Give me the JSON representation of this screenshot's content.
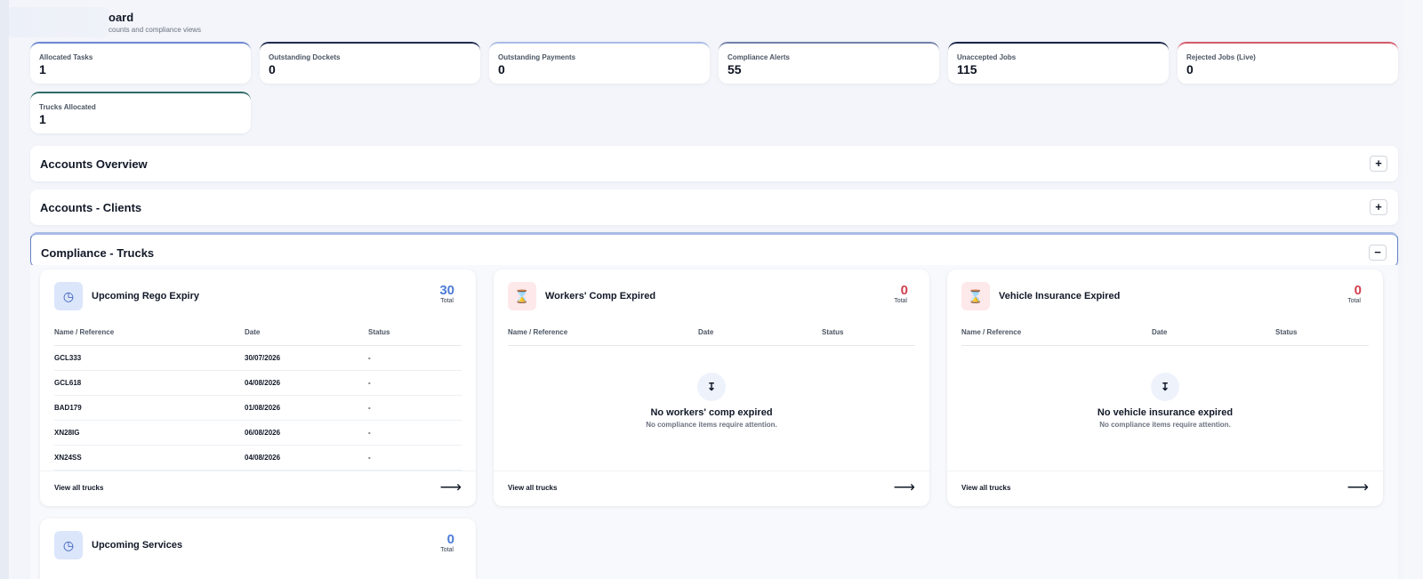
{
  "header": {
    "title_visible": "oard",
    "subtitle_visible": "counts and compliance views"
  },
  "stats": [
    {
      "label": "Allocated Tasks",
      "value": "1",
      "accent": "#6c88d2"
    },
    {
      "label": "Outstanding Dockets",
      "value": "0",
      "accent": "#1f2b4f"
    },
    {
      "label": "Outstanding Payments",
      "value": "0",
      "accent": "#a9bce7"
    },
    {
      "label": "Compliance Alerts",
      "value": "55",
      "accent": "#7280a8"
    },
    {
      "label": "Unaccepted Jobs",
      "value": "115",
      "accent": "#162445"
    },
    {
      "label": "Rejected Jobs (Live)",
      "value": "0",
      "accent": "#d45a6a"
    },
    {
      "label": "Trucks Allocated",
      "value": "1",
      "accent": "#2f6b67"
    }
  ],
  "sections": [
    {
      "title": "Accounts Overview",
      "toggle": "+"
    },
    {
      "title": "Accounts - Clients",
      "toggle": "+"
    },
    {
      "title": "Compliance - Trucks",
      "toggle": "−"
    }
  ],
  "compliance": {
    "columns": {
      "name": "Name / Reference",
      "date": "Date",
      "status": "Status"
    },
    "footer_link": "View all trucks",
    "arrow": "⟶",
    "total_label": "Total",
    "upcoming_rego": {
      "title": "Upcoming Rego Expiry",
      "count": "30",
      "rows": [
        {
          "name": "GCL333",
          "date": "30/07/2026",
          "status": "-"
        },
        {
          "name": "GCL618",
          "date": "04/08/2026",
          "status": "-"
        },
        {
          "name": "BAD179",
          "date": "01/08/2026",
          "status": "-"
        },
        {
          "name": "XN28IG",
          "date": "06/08/2026",
          "status": "-"
        },
        {
          "name": "XN24SS",
          "date": "04/08/2026",
          "status": "-"
        }
      ]
    },
    "workers_comp": {
      "title": "Workers' Comp Expired",
      "count": "0",
      "empty_title": "No workers' comp expired",
      "empty_sub": "No compliance items require attention."
    },
    "vehicle_insurance": {
      "title": "Vehicle Insurance Expired",
      "count": "0",
      "empty_title": "No vehicle insurance expired",
      "empty_sub": "No compliance items require attention."
    },
    "upcoming_services": {
      "title": "Upcoming Services",
      "count": "0"
    }
  },
  "icons": {
    "clock": "clock-icon",
    "alert": "alert-icon",
    "empty_state": "upload-icon"
  }
}
